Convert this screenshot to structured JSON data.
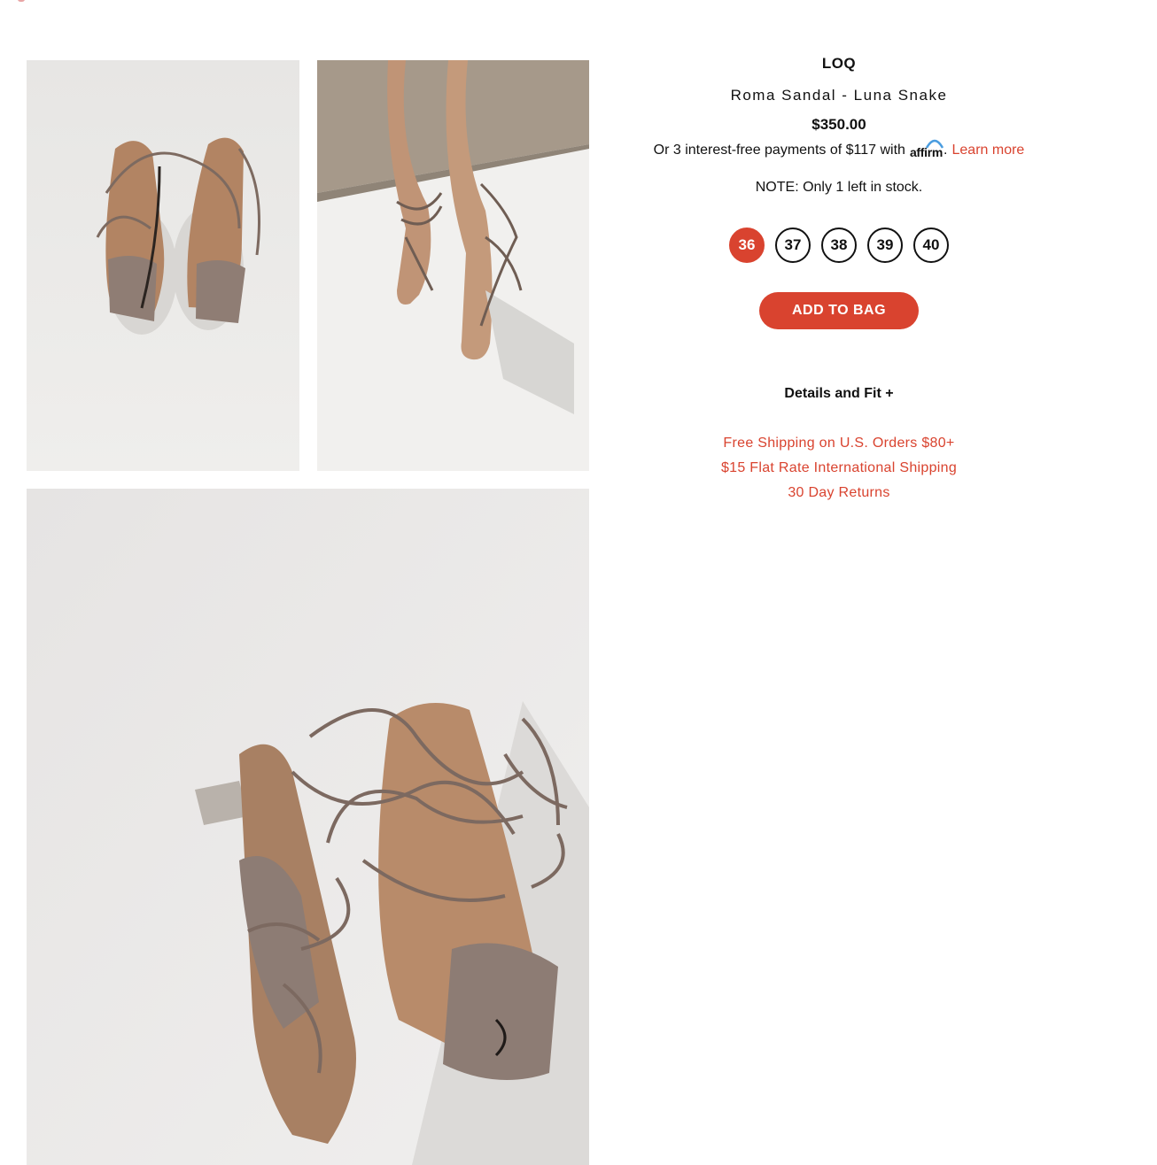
{
  "colors": {
    "accent": "#d9432f",
    "text": "#111111",
    "background": "#ffffff"
  },
  "product": {
    "brand": "LOQ",
    "title": "Roma Sandal - Luna Snake",
    "price": "$350.00",
    "affirm": {
      "prefix": "Or 3 interest-free payments of $117 with",
      "logo_text": "affirm",
      "period": ".",
      "link": "Learn more"
    },
    "stock_note": "NOTE: Only 1 left in stock.",
    "sizes": [
      "36",
      "37",
      "38",
      "39",
      "40"
    ],
    "selected_size": "36",
    "add_to_bag": "ADD TO BAG",
    "details_toggle": "Details and Fit +"
  },
  "policies": [
    "Free Shipping on U.S. Orders $80+",
    "$15 Flat Rate International Shipping",
    "30 Day Returns"
  ],
  "gallery": {
    "images": [
      {
        "name": "product-image-pair-top-view"
      },
      {
        "name": "product-image-on-feet"
      },
      {
        "name": "product-image-single-angle"
      }
    ]
  }
}
